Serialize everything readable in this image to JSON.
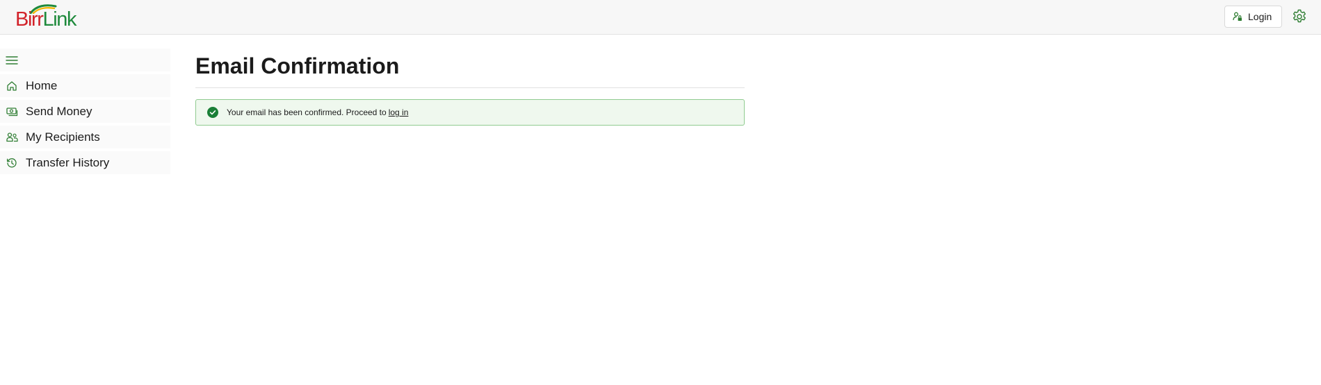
{
  "brand": {
    "name_part1": "Birr",
    "name_part2": "Link",
    "colors": {
      "red": "#d2232a",
      "green": "#1e8a3c",
      "accent_yellow": "#f2b705"
    }
  },
  "header": {
    "login_label": "Login",
    "login_icon": "person-lock-icon",
    "settings_icon": "gear-icon"
  },
  "sidebar": {
    "menu_icon": "hamburger-icon",
    "items": [
      {
        "label": "Home",
        "icon": "home-icon"
      },
      {
        "label": "Send Money",
        "icon": "money-icon"
      },
      {
        "label": "My Recipients",
        "icon": "people-icon"
      },
      {
        "label": "Transfer History",
        "icon": "history-icon"
      }
    ]
  },
  "main": {
    "title": "Email Confirmation",
    "alert": {
      "text": "Your email has been confirmed. Proceed to",
      "link_text": "log in",
      "icon": "checkmark-circle-icon",
      "colors": {
        "background": "#eff8ee",
        "border": "#8fcb8f",
        "icon": "#1a7f37"
      }
    }
  }
}
